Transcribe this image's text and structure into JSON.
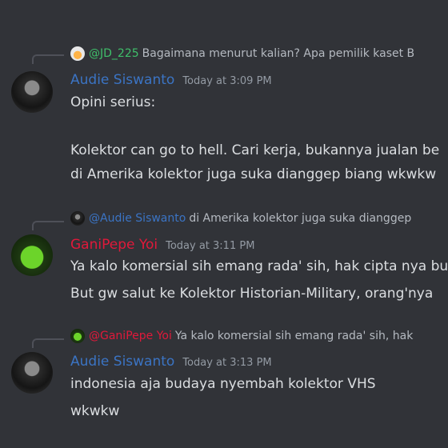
{
  "colors": {
    "background": "#313338",
    "text": "#dbdee1",
    "timestamp": "#949ba4",
    "audie_name": "#3b74c4",
    "ganipepe_name": "#e0193a",
    "jd_name": "#3fbf6a"
  },
  "messages": [
    {
      "reply": {
        "avatar": "fire-avatar-icon",
        "author": "@JD_225",
        "text": "Bagaimana menurut kalian? Apa pemilik kaset B"
      },
      "author": "Audie Siswanto",
      "avatar": "dark-portrait-avatar",
      "timestamp": "Today at 3:09 PM",
      "lines": [
        "Opini serius:",
        "",
        "Kolektor can go to hell. Cari kerja, bukannya jualan be",
        "di Amerika kolektor juga suka dianggep biang wkwkw"
      ]
    },
    {
      "reply": {
        "avatar": "dark-portrait-avatar",
        "author": "@Audie Siswanto",
        "text": "di Amerika kolektor juga suka dianggep"
      },
      "author": "GaniPepe Yoi",
      "avatar": "green-pepe-avatar",
      "timestamp": "Today at 3:11 PM",
      "lines": [
        "Ya kalo komersial sih emang rada' sih, hak cipta nya bu",
        "But gw salut ke Kolektor Historian-Military, orang'nya"
      ]
    },
    {
      "reply": {
        "avatar": "green-pepe-avatar",
        "author": "@GaniPepe Yoi",
        "text": "Ya kalo komersial sih emang rada' sih, hak"
      },
      "author": "Audie Siswanto",
      "avatar": "dark-portrait-avatar",
      "timestamp": "Today at 3:13 PM",
      "lines": [
        "indonesia aja budaya nyembah kolektor VHS",
        "wkwkw"
      ]
    }
  ]
}
